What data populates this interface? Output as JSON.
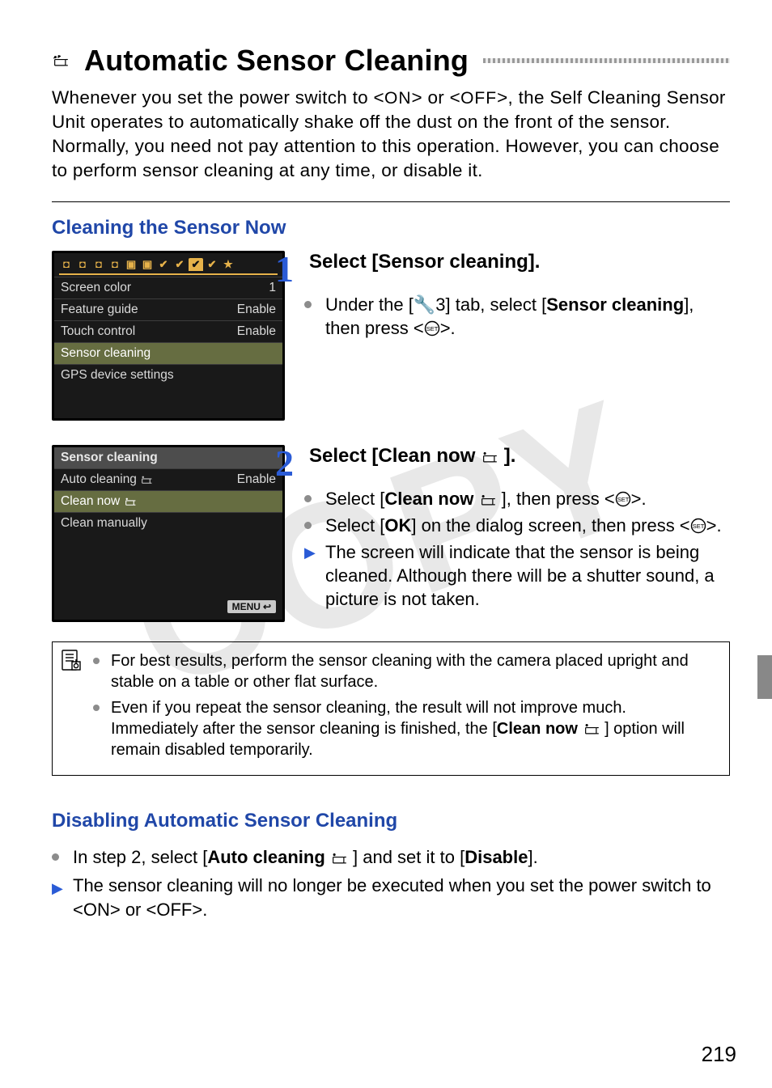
{
  "watermark": "COPY",
  "page_number": "219",
  "title": {
    "icon": "sensor-clean-icon",
    "text": "Automatic Sensor Cleaning"
  },
  "intro": {
    "pre": "Whenever you set the power switch to <",
    "on": "ON",
    "mid1": "> or <",
    "off": "OFF",
    "mid2": ">, the Self Cleaning Sensor Unit operates to automatically shake off the dust on the front of the sensor. Normally, you need not pay attention to this operation. However, you can choose to perform sensor cleaning at any time, or disable it."
  },
  "section_cleaning_now": "Cleaning the Sensor Now",
  "lcd1": {
    "tabs_star": "★",
    "items": [
      {
        "label": "Screen color",
        "value": "1"
      },
      {
        "label": "Feature guide",
        "value": "Enable"
      },
      {
        "label": "Touch control",
        "value": "Enable"
      },
      {
        "label": "Sensor cleaning",
        "value": "",
        "selected": true
      },
      {
        "label": "GPS device settings",
        "value": ""
      }
    ]
  },
  "lcd2": {
    "head": "Sensor cleaning",
    "items": [
      {
        "label": "Auto cleaning",
        "icon": true,
        "value": "Enable"
      },
      {
        "label": "Clean now",
        "icon": true,
        "value": "",
        "selected": true
      },
      {
        "label": "Clean manually",
        "value": ""
      }
    ],
    "menu_label": "MENU",
    "menu_return_glyph": "↩"
  },
  "step1": {
    "num": "1",
    "title": "Select [Sensor cleaning].",
    "b1_pre": "Under the [",
    "b1_tab": "3",
    "b1_mid": "] tab, select [",
    "b1_bold": "Sensor cleaning",
    "b1_post": "], then press <",
    "b1_end": ">."
  },
  "step2": {
    "num": "2",
    "title_pre": "Select [Clean now",
    "title_post": "].",
    "b1_pre": "Select [",
    "b1_bold": "Clean now",
    "b1_post": "], then press <",
    "b1_end": ">.",
    "b2_pre": "Select [",
    "b2_bold": "OK",
    "b2_mid": "] on the dialog screen, then press <",
    "b2_end": ">.",
    "b3": "The screen will indicate that the sensor is being cleaned. Although there will be a shutter sound, a picture is not taken."
  },
  "notes": {
    "n1": "For best results, perform the sensor cleaning with the camera placed upright and stable on a table or other flat surface.",
    "n2_pre": "Even if you repeat the sensor cleaning, the result will not improve much. Immediately after the sensor cleaning is finished, the [",
    "n2_bold": "Clean now",
    "n2_post": "] option will remain disabled temporarily."
  },
  "section_disable": "Disabling Automatic Sensor Cleaning",
  "disable": {
    "b1_pre": "In step 2, select [",
    "b1_bold": "Auto cleaning",
    "b1_mid": "] and set it to [",
    "b1_bold2": "Disable",
    "b1_post": "].",
    "b2_pre": "The sensor cleaning will no longer be executed when you set the power switch to <",
    "b2_on": "ON",
    "b2_mid": "> or <",
    "b2_off": "OFF",
    "b2_post": ">."
  }
}
